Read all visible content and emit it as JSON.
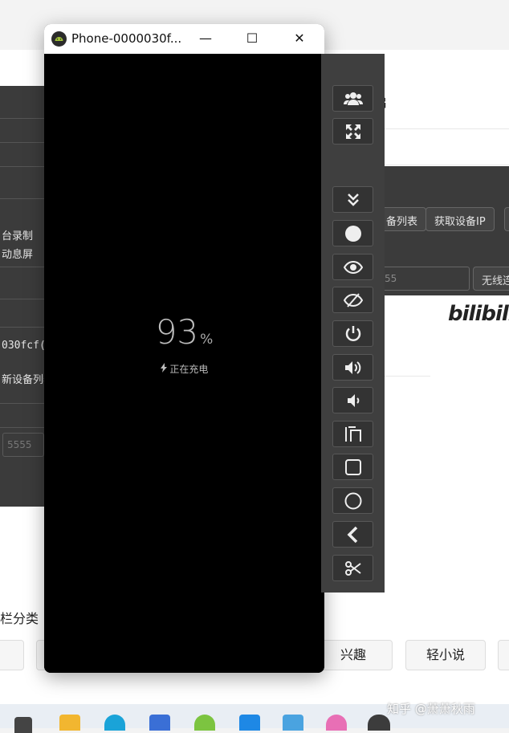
{
  "window": {
    "title": "Phone-0000030f...",
    "minimize_glyph": "—",
    "maximize_glyph": "☐",
    "close_glyph": "✕"
  },
  "phone_screen": {
    "battery_level": "93",
    "percent_sign": "%",
    "charging_text": "正在充电"
  },
  "left_panel": {
    "texts": [
      "台录制",
      "动息屏",
      "030fcf(",
      "新设备列表"
    ],
    "port_placeholder": "5555"
  },
  "right_panel": {
    "buttons": [
      "备列表",
      "获取设备IP"
    ],
    "ip_placeholder": "55",
    "wireless_button": "无线连"
  },
  "background": {
    "heading_fragment": "启",
    "logo_text": "bilibili"
  },
  "categories": {
    "label": "栏分类",
    "pills": [
      "兴趣",
      "轻小说"
    ]
  },
  "watermark": "知乎 @萧萧秋雨",
  "toolbar": {
    "buttons": [
      "users-icon",
      "fullscreen-icon",
      "chevron-double-down-icon",
      "record-icon",
      "eye-icon",
      "eye-off-icon",
      "power-icon",
      "volume-up-icon",
      "volume-down-icon",
      "rotate-icon",
      "square-icon",
      "circle-icon",
      "back-icon",
      "scissors-icon"
    ]
  },
  "colors": {
    "toolbar_bg": "#3f3f3f",
    "screen_bg": "#000000",
    "battery_text": "#bdbdbd"
  }
}
